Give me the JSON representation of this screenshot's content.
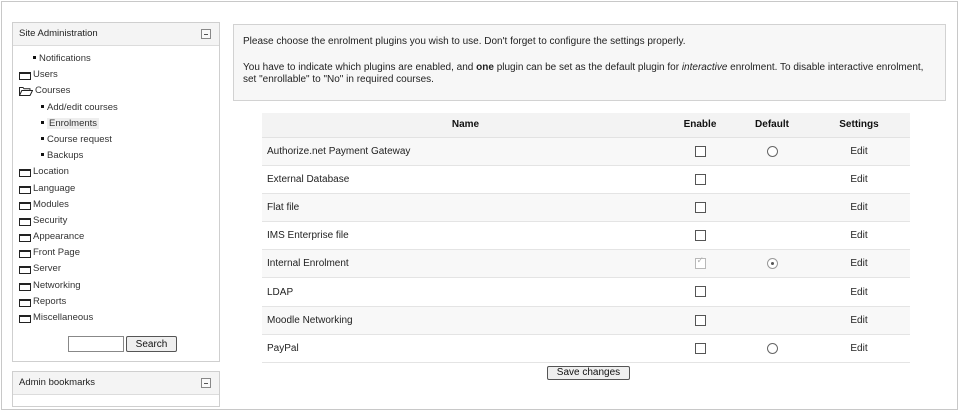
{
  "sidebar": {
    "admin_title": "Site Administration",
    "items": [
      {
        "label": "Notifications"
      },
      {
        "label": "Users"
      },
      {
        "label": "Courses"
      },
      {
        "label": "Add/edit courses"
      },
      {
        "label": "Enrolments"
      },
      {
        "label": "Course request"
      },
      {
        "label": "Backups"
      },
      {
        "label": "Location"
      },
      {
        "label": "Language"
      },
      {
        "label": "Modules"
      },
      {
        "label": "Security"
      },
      {
        "label": "Appearance"
      },
      {
        "label": "Front Page"
      },
      {
        "label": "Server"
      },
      {
        "label": "Networking"
      },
      {
        "label": "Reports"
      },
      {
        "label": "Miscellaneous"
      }
    ],
    "search_value": "",
    "search_button": "Search",
    "bookmarks_title": "Admin bookmarks"
  },
  "info": {
    "line1": "Please choose the enrolment plugins you wish to use. Don't forget to configure the settings properly.",
    "line2_a": "You have to indicate which plugins are enabled, and ",
    "line2_bold": "one",
    "line2_b": " plugin can be set as the default plugin for ",
    "line2_italic": "interactive",
    "line2_c": " enrolment. To disable interactive enrolment, set \"enrollable\" to \"No\" in required courses."
  },
  "table": {
    "headers": {
      "name": "Name",
      "enable": "Enable",
      "default": "Default",
      "settings": "Settings"
    },
    "rows": [
      {
        "name": "Authorize.net Payment Gateway",
        "enabled": false,
        "enable_disabled": false,
        "default_radio": true,
        "default_selected": false,
        "edit": "Edit"
      },
      {
        "name": "External Database",
        "enabled": false,
        "enable_disabled": false,
        "default_radio": false,
        "default_selected": false,
        "edit": "Edit"
      },
      {
        "name": "Flat file",
        "enabled": false,
        "enable_disabled": false,
        "default_radio": false,
        "default_selected": false,
        "edit": "Edit"
      },
      {
        "name": "IMS Enterprise file",
        "enabled": false,
        "enable_disabled": false,
        "default_radio": false,
        "default_selected": false,
        "edit": "Edit"
      },
      {
        "name": "Internal Enrolment",
        "enabled": true,
        "enable_disabled": true,
        "default_radio": true,
        "default_selected": true,
        "edit": "Edit"
      },
      {
        "name": "LDAP",
        "enabled": false,
        "enable_disabled": false,
        "default_radio": false,
        "default_selected": false,
        "edit": "Edit"
      },
      {
        "name": "Moodle Networking",
        "enabled": false,
        "enable_disabled": false,
        "default_radio": false,
        "default_selected": false,
        "edit": "Edit"
      },
      {
        "name": "PayPal",
        "enabled": false,
        "enable_disabled": false,
        "default_radio": true,
        "default_selected": false,
        "edit": "Edit"
      }
    ]
  },
  "save_button": "Save changes"
}
